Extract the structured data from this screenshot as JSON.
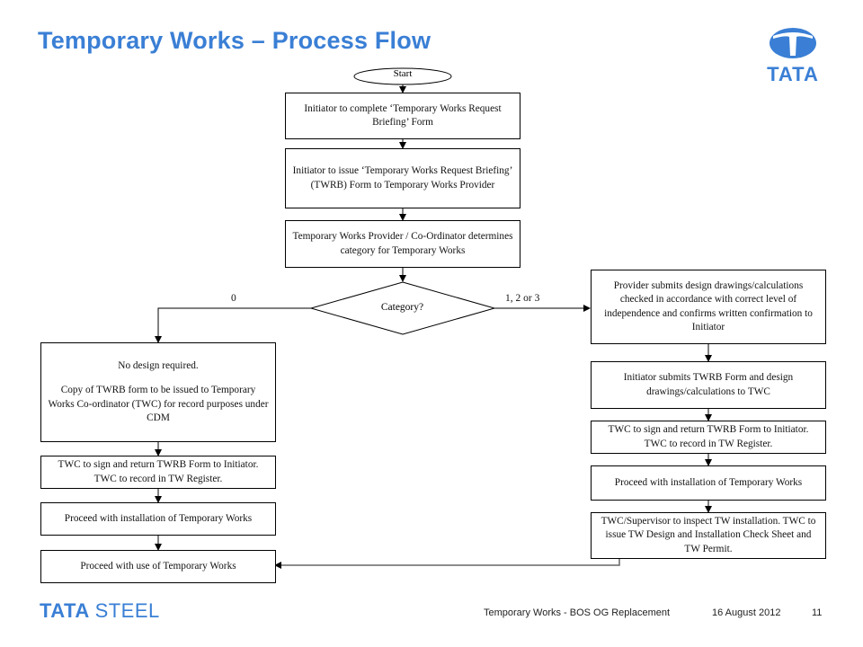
{
  "slide": {
    "title": "Temporary Works – Process Flow",
    "brand_color": "#3a7fd5"
  },
  "logo": {
    "icon": "tata-emblem-icon",
    "text": "TATA"
  },
  "flow": {
    "start": "Start",
    "center": [
      "Initiator to complete ‘Temporary Works Request Briefing’  Form",
      "Initiator to issue ‘Temporary Works Request Briefing’ (TWRB) Form to Temporary Works Provider",
      "Temporary Works Provider / Co-Ordinator determines category for Temporary Works"
    ],
    "decision": "Category?",
    "branch_left_label": "0",
    "branch_right_label": "1, 2 or 3",
    "left": {
      "no_design_line1": "No design required.",
      "no_design_line2": "Copy of TWRB form to be issued to Temporary Works Co-ordinator (TWC)  for record purposes under CDM",
      "sign_return": "TWC to sign and return TWRB Form to Initiator. TWC to record in TW Register.",
      "install": "Proceed with installation of Temporary Works",
      "use": "Proceed with use of Temporary Works"
    },
    "right": {
      "provider_submits": "Provider submits design drawings/calculations checked in accordance with correct level of independence and confirms written confirmation to Initiator",
      "initiator_submits": "Initiator submits TWRB Form and design drawings/calculations to TWC",
      "sign_return": "TWC to sign and return TWRB Form to Initiator. TWC to record in TW Register.",
      "install": "Proceed with installation of Temporary Works",
      "inspect": "TWC/Supervisor to inspect TW installation. TWC to issue TW Design and Installation Check Sheet and TW Permit."
    }
  },
  "footer": {
    "brand_main": "TATA",
    "brand_sub": "STEEL",
    "presentation": "Temporary Works - BOS OG Replacement",
    "date": "16 August 2012",
    "page": "11"
  }
}
